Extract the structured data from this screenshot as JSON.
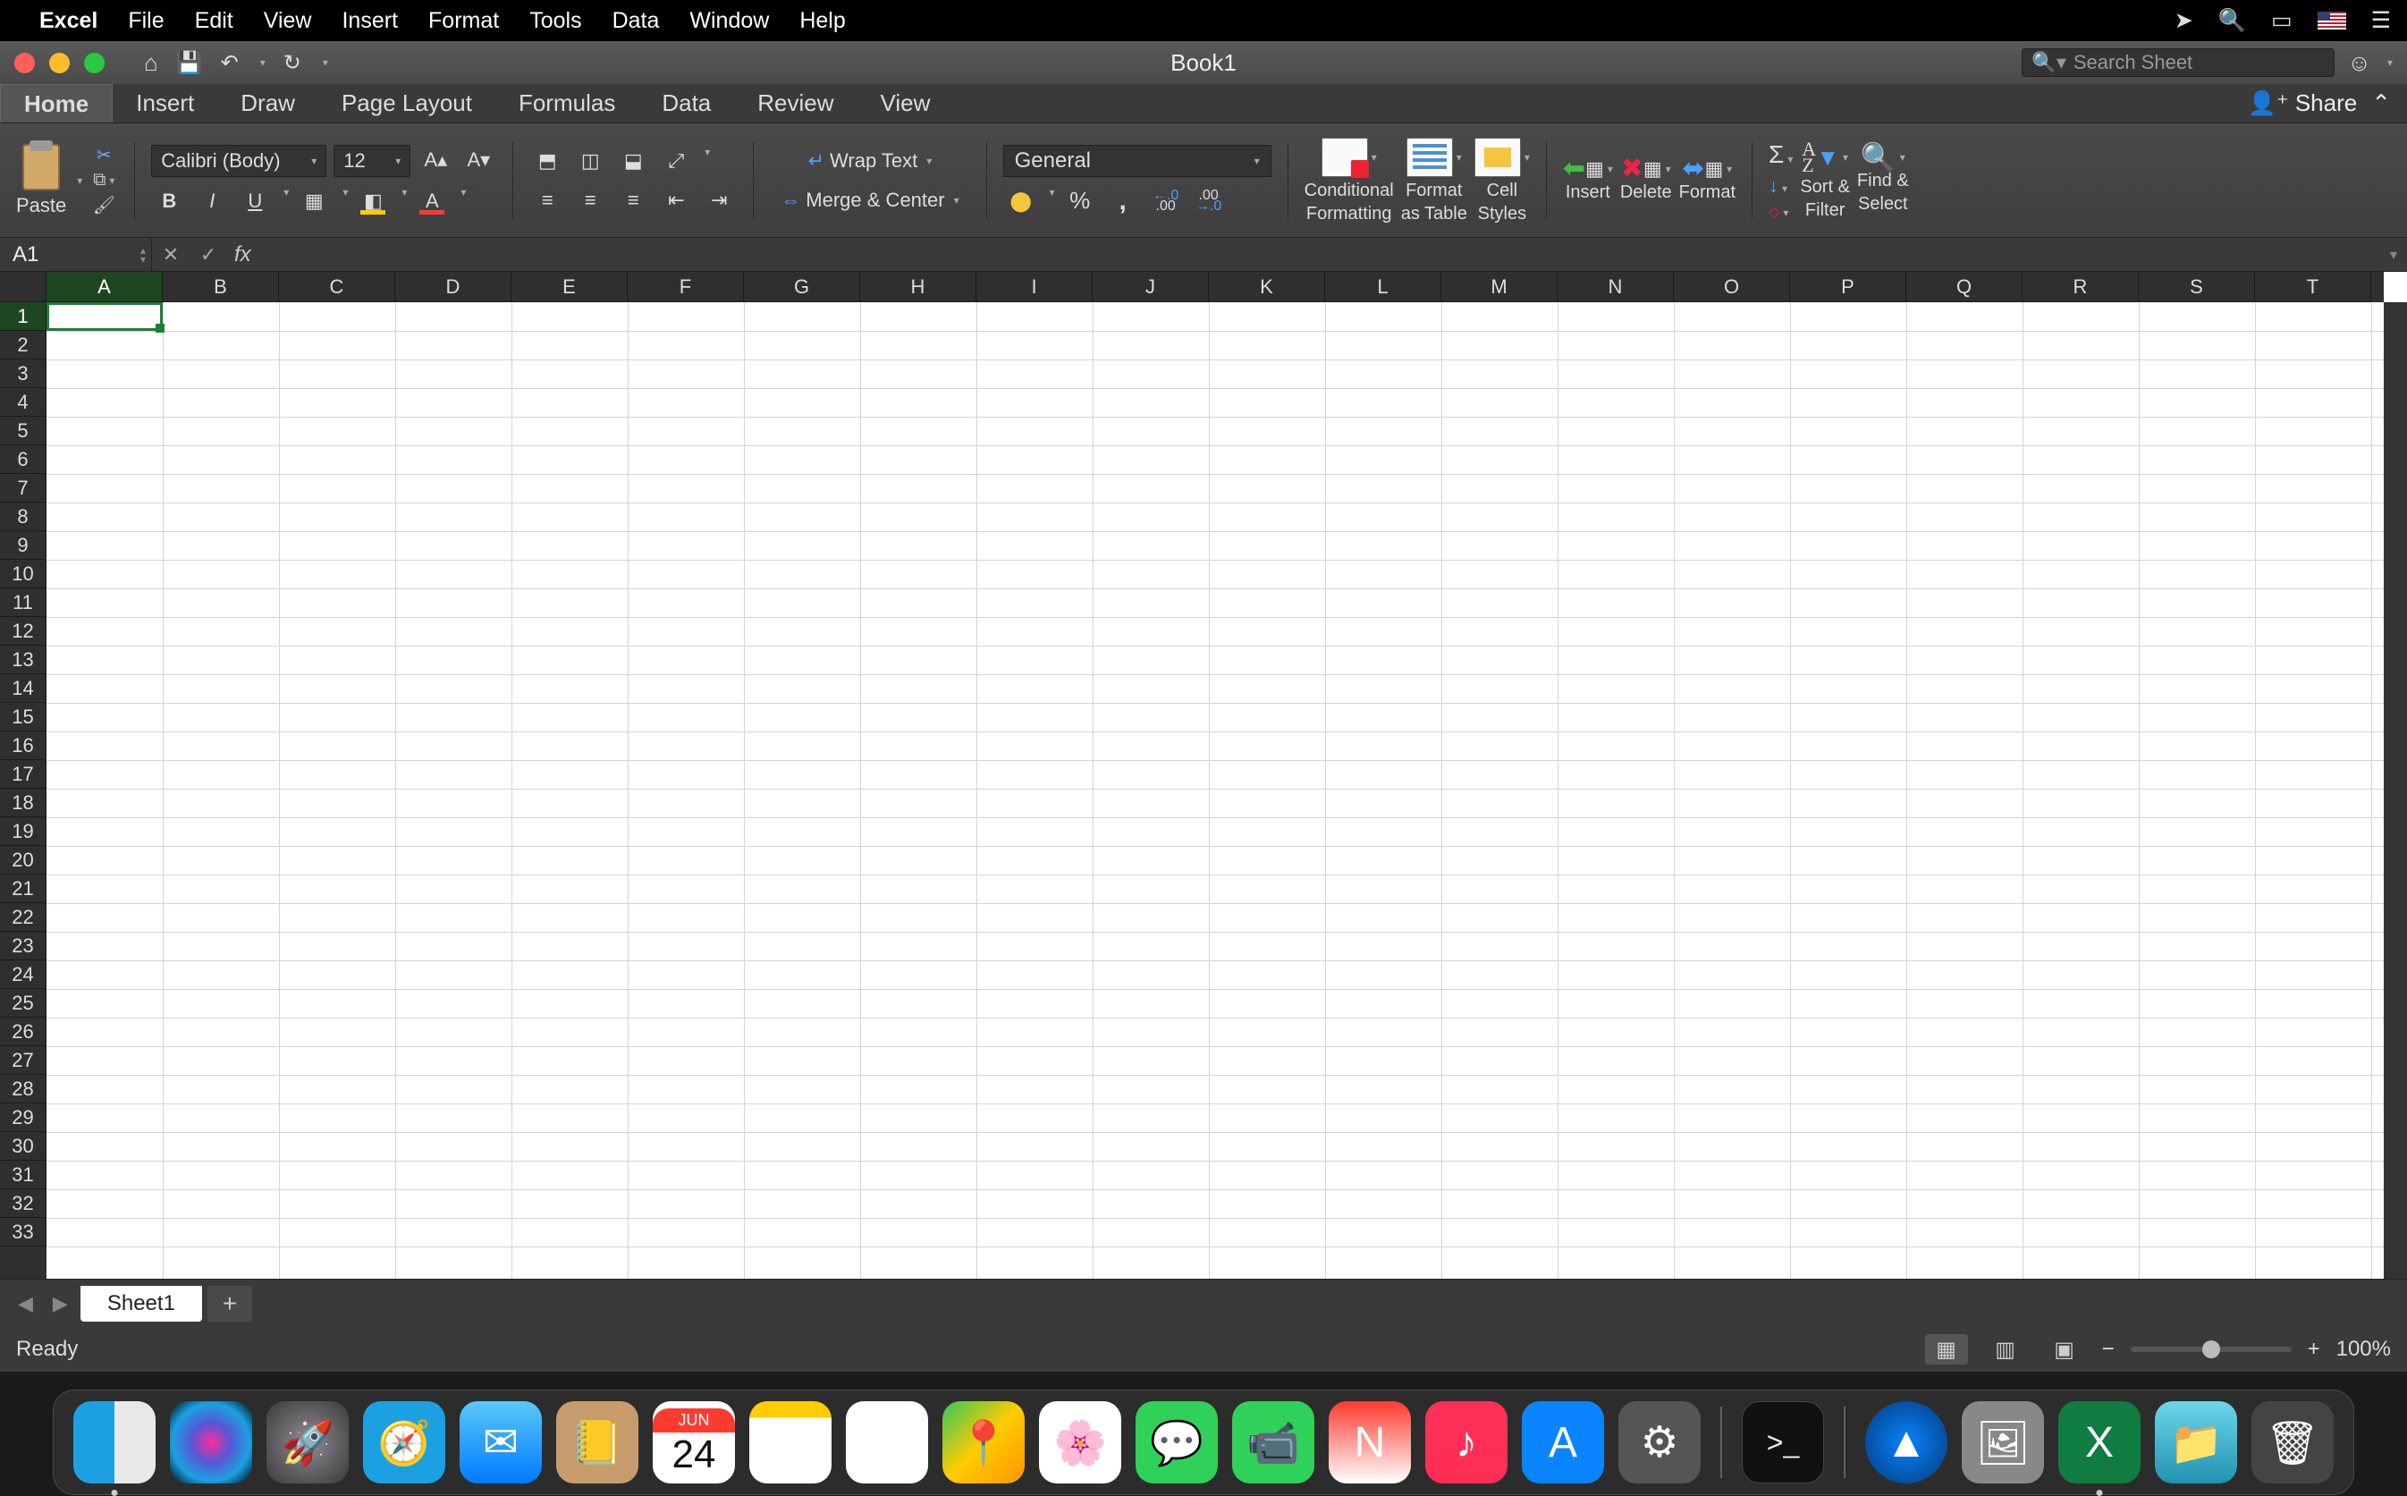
{
  "menubar": {
    "app_name": "Excel",
    "items": [
      "File",
      "Edit",
      "View",
      "Insert",
      "Format",
      "Tools",
      "Data",
      "Window",
      "Help"
    ]
  },
  "titlebar": {
    "doc_title": "Book1",
    "search_placeholder": "Search Sheet"
  },
  "ribbon_tabs": {
    "tabs": [
      "Home",
      "Insert",
      "Draw",
      "Page Layout",
      "Formulas",
      "Data",
      "Review",
      "View"
    ],
    "active": "Home",
    "share_label": "Share"
  },
  "ribbon": {
    "paste_label": "Paste",
    "font_name": "Calibri (Body)",
    "font_size": "12",
    "wrap_text_label": "Wrap Text",
    "merge_center_label": "Merge & Center",
    "number_format": "General",
    "cond_fmt_label_1": "Conditional",
    "cond_fmt_label_2": "Formatting",
    "fmt_table_label_1": "Format",
    "fmt_table_label_2": "as Table",
    "cell_styles_label_1": "Cell",
    "cell_styles_label_2": "Styles",
    "insert_label": "Insert",
    "delete_label": "Delete",
    "format_label": "Format",
    "sort_filter_label_1": "Sort &",
    "sort_filter_label_2": "Filter",
    "find_select_label_1": "Find &",
    "find_select_label_2": "Select"
  },
  "formula_bar": {
    "cell_ref": "A1",
    "fx_label": "fx",
    "formula_value": ""
  },
  "grid": {
    "columns": [
      "A",
      "B",
      "C",
      "D",
      "E",
      "F",
      "G",
      "H",
      "I",
      "J",
      "K",
      "L",
      "M",
      "N",
      "O",
      "P",
      "Q",
      "R",
      "S",
      "T"
    ],
    "rows": [
      "1",
      "2",
      "3",
      "4",
      "5",
      "6",
      "7",
      "8",
      "9",
      "10",
      "11",
      "12",
      "13",
      "14",
      "15",
      "16",
      "17",
      "18",
      "19",
      "20",
      "21",
      "22",
      "23",
      "24",
      "25",
      "26",
      "27",
      "28",
      "29",
      "30",
      "31",
      "32",
      "33"
    ],
    "selected_col": "A",
    "selected_row": "1"
  },
  "sheet_tabs": {
    "active_sheet": "Sheet1"
  },
  "statusbar": {
    "status_text": "Ready",
    "zoom_pct": "100%"
  },
  "dock": {
    "calendar_month": "JUN",
    "calendar_day": "24"
  }
}
